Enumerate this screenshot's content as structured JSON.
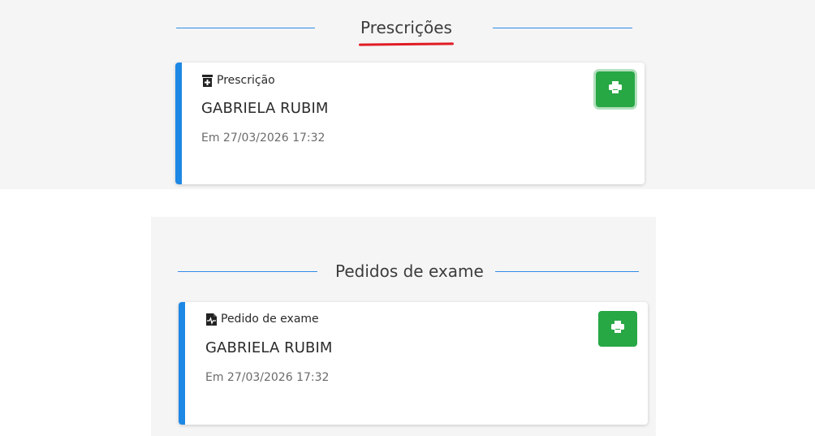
{
  "colors": {
    "accent_blue": "#1e88e5",
    "rule_blue": "#2f8ce8",
    "print_green": "#28a745",
    "underline_red": "#e01b24"
  },
  "prescriptions": {
    "section_title": "Prescrições",
    "card": {
      "type_label": "Prescrição",
      "type_icon": "prescription-bottle-icon",
      "patient_name": "GABRIELA RUBIM",
      "date": "Em 27/03/2026 17:32",
      "print_icon": "print-icon"
    }
  },
  "exam_requests": {
    "section_title": "Pedidos de exame",
    "card": {
      "type_label": "Pedido de exame",
      "type_icon": "file-medical-icon",
      "patient_name": "GABRIELA RUBIM",
      "date": "Em 27/03/2026 17:32",
      "print_icon": "print-icon"
    }
  }
}
